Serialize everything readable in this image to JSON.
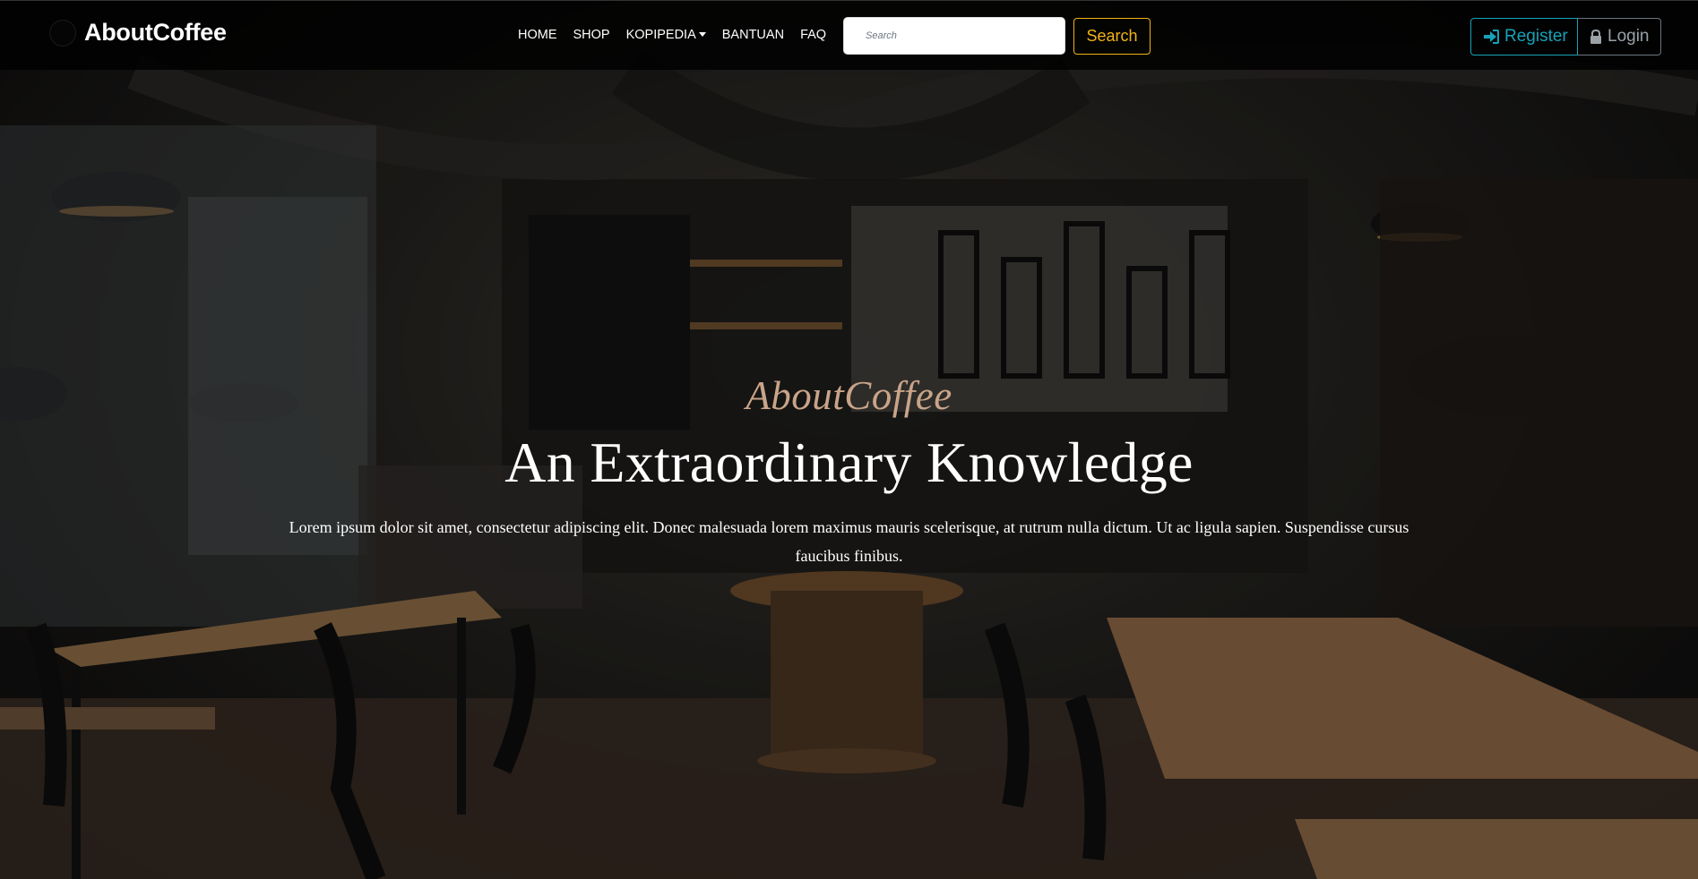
{
  "navbar": {
    "brand": "AboutCoffee",
    "links": [
      {
        "label": "HOME"
      },
      {
        "label": "SHOP"
      },
      {
        "label": "KOPIPEDIA"
      },
      {
        "label": "BANTUAN"
      },
      {
        "label": "FAQ"
      }
    ],
    "search": {
      "placeholder": "Search",
      "value": "",
      "button_label": "Search"
    },
    "register_label": "Register",
    "login_label": "Login"
  },
  "hero": {
    "subtitle": "AboutCoffee",
    "title": "An Extraordinary Knowledge",
    "description": "Lorem ipsum dolor sit amet, consectetur adipiscing elit. Donec malesuada lorem maximus mauris scelerisque, at rutrum nulla dictum. Ut ac ligula sapien. Suspendisse cursus faucibus finibus."
  },
  "colors": {
    "accent_yellow": "#f1b416",
    "register_teal": "#17a2b8",
    "login_gray": "#6c757d",
    "subtitle_tan": "#c9a489",
    "navbar_bg": "#000000"
  }
}
